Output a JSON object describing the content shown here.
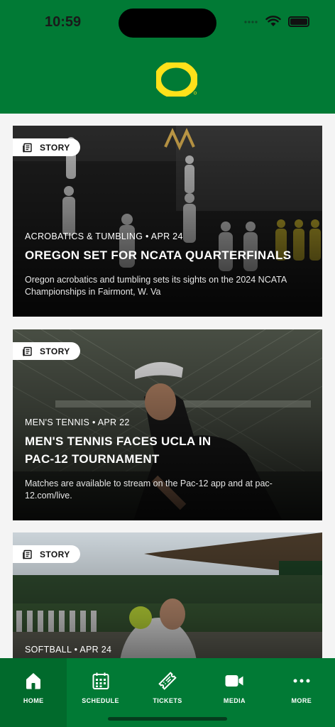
{
  "status_bar": {
    "time": "10:59"
  },
  "brand": {
    "name": "Oregon Ducks",
    "primary": "#017a35",
    "accent": "#fee11a"
  },
  "feed": {
    "cards": [
      {
        "badge": "STORY",
        "meta": "ACROBATICS & TUMBLING • APR 24",
        "title_lines": [
          "OREGON SET FOR NCATA QUARTERFINALS"
        ],
        "desc_lines": [
          "Oregon acrobatics and tumbling sets its sights on the 2024 NCATA",
          "Championships in Fairmont, W. Va"
        ]
      },
      {
        "badge": "STORY",
        "meta": "MEN'S TENNIS • APR 22",
        "title_lines": [
          "MEN'S TENNIS FACES UCLA IN",
          "PAC-12 TOURNAMENT"
        ],
        "desc_lines": [
          "Matches are available to stream on the Pac-12 app and at pac-12.com/live."
        ]
      },
      {
        "badge": "STORY",
        "meta": "SOFTBALL • APR 24",
        "title_lines": [],
        "desc_lines": []
      }
    ]
  },
  "tabbar": {
    "items": [
      {
        "label": "HOME",
        "icon": "home-icon",
        "active": true
      },
      {
        "label": "SCHEDULE",
        "icon": "calendar-icon",
        "active": false
      },
      {
        "label": "TICKETS",
        "icon": "ticket-icon",
        "active": false
      },
      {
        "label": "MEDIA",
        "icon": "video-camera-icon",
        "active": false
      },
      {
        "label": "MORE",
        "icon": "more-dots-icon",
        "active": false
      }
    ]
  }
}
